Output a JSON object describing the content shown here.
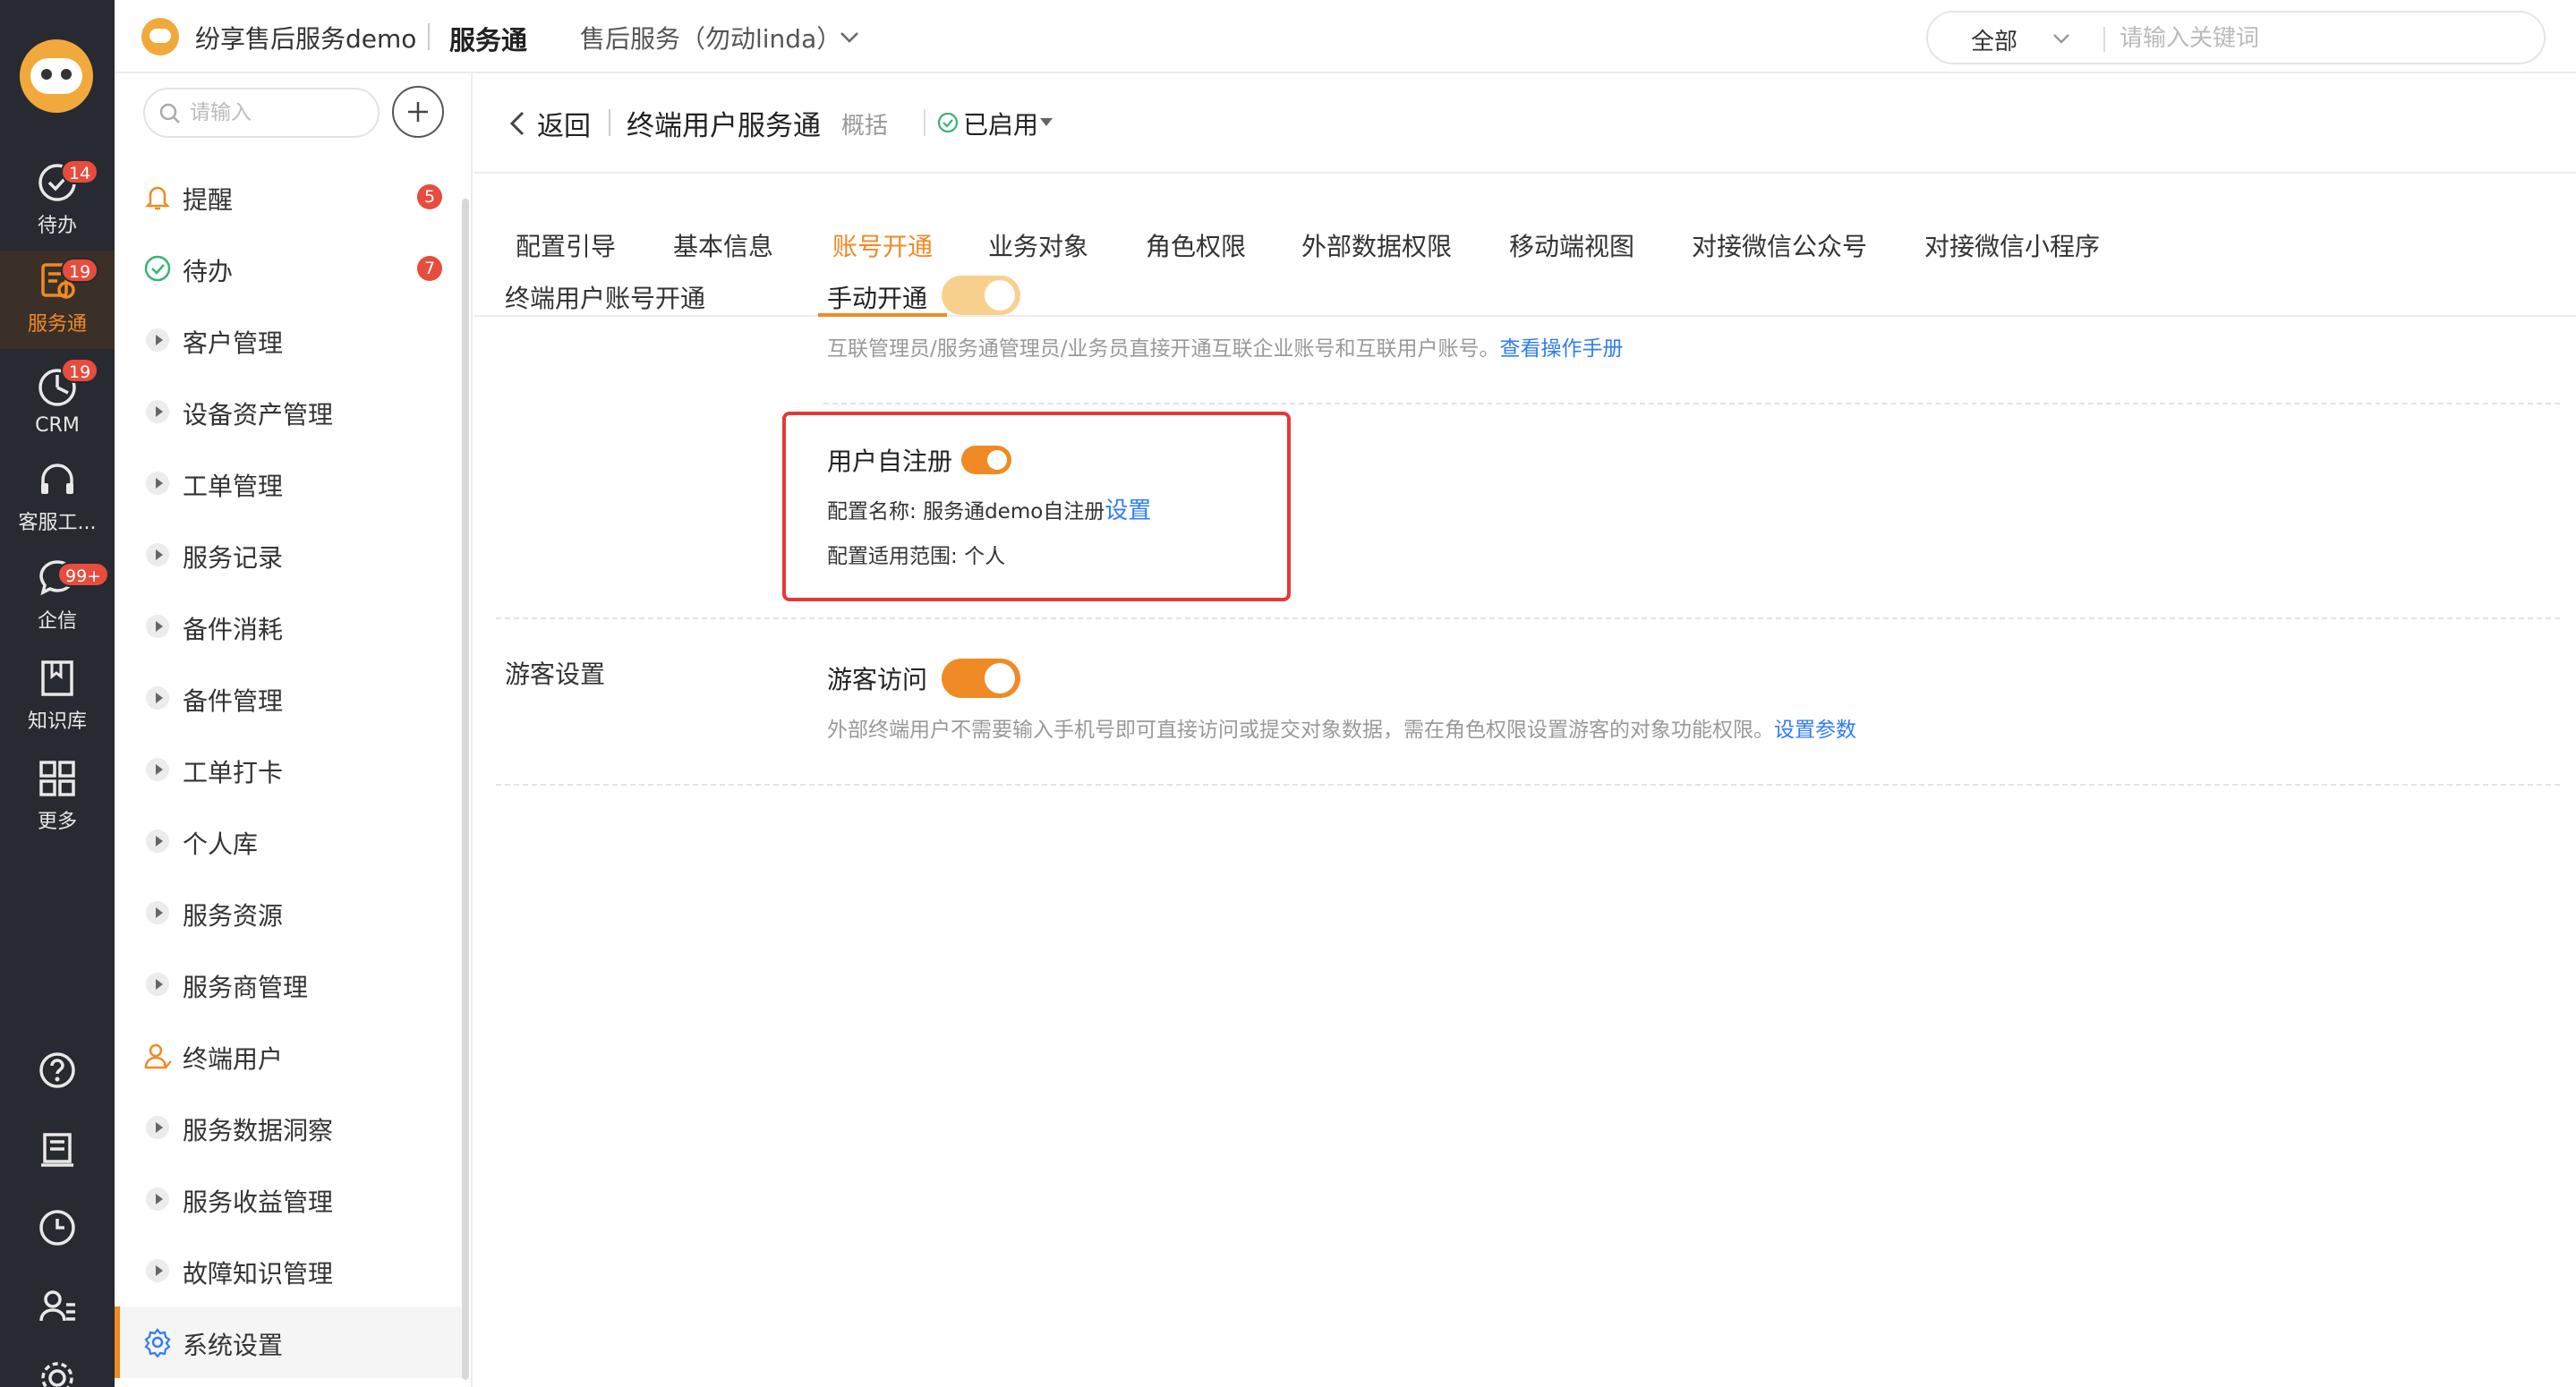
{
  "rail": {
    "items": [
      {
        "label": "待办",
        "badge": "14",
        "icon": "check-circle-icon"
      },
      {
        "label": "服务通",
        "badge": "19",
        "icon": "service-icon",
        "active": true
      },
      {
        "label": "CRM",
        "badge": "19",
        "icon": "chart-clock-icon"
      },
      {
        "label": "客服工...",
        "badge": "",
        "icon": "headset-icon"
      },
      {
        "label": "企信",
        "badge": "99+",
        "icon": "chat-icon"
      },
      {
        "label": "知识库",
        "badge": "",
        "icon": "book-icon"
      },
      {
        "label": "更多",
        "badge": "",
        "icon": "grid-icon"
      }
    ],
    "bottom_icons": [
      "help-icon",
      "notebook-icon",
      "clock-icon",
      "user-list-icon",
      "settings-icon"
    ]
  },
  "topbar": {
    "company": "纷享售后服务demo",
    "app": "服务通",
    "org": "售后服务（勿动linda）",
    "search_scope": "全部",
    "search_placeholder": "请输入关键词"
  },
  "sidebar": {
    "search_placeholder": "请输入",
    "items": [
      {
        "label": "提醒",
        "count": "5",
        "icon": "bell-icon"
      },
      {
        "label": "待办",
        "count": "7",
        "icon": "check-circle-icon"
      },
      {
        "label": "客户管理"
      },
      {
        "label": "设备资产管理"
      },
      {
        "label": "工单管理"
      },
      {
        "label": "服务记录"
      },
      {
        "label": "备件消耗"
      },
      {
        "label": "备件管理"
      },
      {
        "label": "工单打卡"
      },
      {
        "label": "个人库"
      },
      {
        "label": "服务资源"
      },
      {
        "label": "服务商管理"
      },
      {
        "label": "终端用户",
        "icon": "user-icon"
      },
      {
        "label": "服务数据洞察"
      },
      {
        "label": "服务收益管理"
      },
      {
        "label": "故障知识管理"
      },
      {
        "label": "系统设置",
        "icon": "gear-icon",
        "active": true
      }
    ]
  },
  "header": {
    "back": "返回",
    "title": "终端用户服务通",
    "subtitle": "概括",
    "status": "已启用"
  },
  "tabs": [
    "配置引导",
    "基本信息",
    "账号开通",
    "业务对象",
    "角色权限",
    "外部数据权限",
    "移动端视图",
    "对接微信公众号",
    "对接微信小程序"
  ],
  "active_tab": "账号开通",
  "account_section": {
    "label": "终端用户账号开通",
    "manual": {
      "label": "手动开通",
      "desc": "互联管理员/服务通管理员/业务员直接开通互联企业账号和互联用户账号。",
      "link": "查看操作手册"
    },
    "self_register": {
      "label": "用户自注册",
      "config_name_key": "配置名称:",
      "config_name_value": "服务通demo自注册",
      "config_name_link": "设置",
      "scope_key": "配置适用范围:",
      "scope_value": "个人"
    }
  },
  "guest_section": {
    "label": "游客设置",
    "toggle_label": "游客访问",
    "desc": "外部终端用户不需要输入手机号即可直接访问或提交对象数据，需在角色权限设置游客的对象功能权限。",
    "link": "设置参数"
  },
  "colors": {
    "accent": "#f08a24",
    "link": "#2f7cf6",
    "badge": "#e74c3c",
    "highlight": "#e53935",
    "rail": "#272a30"
  }
}
